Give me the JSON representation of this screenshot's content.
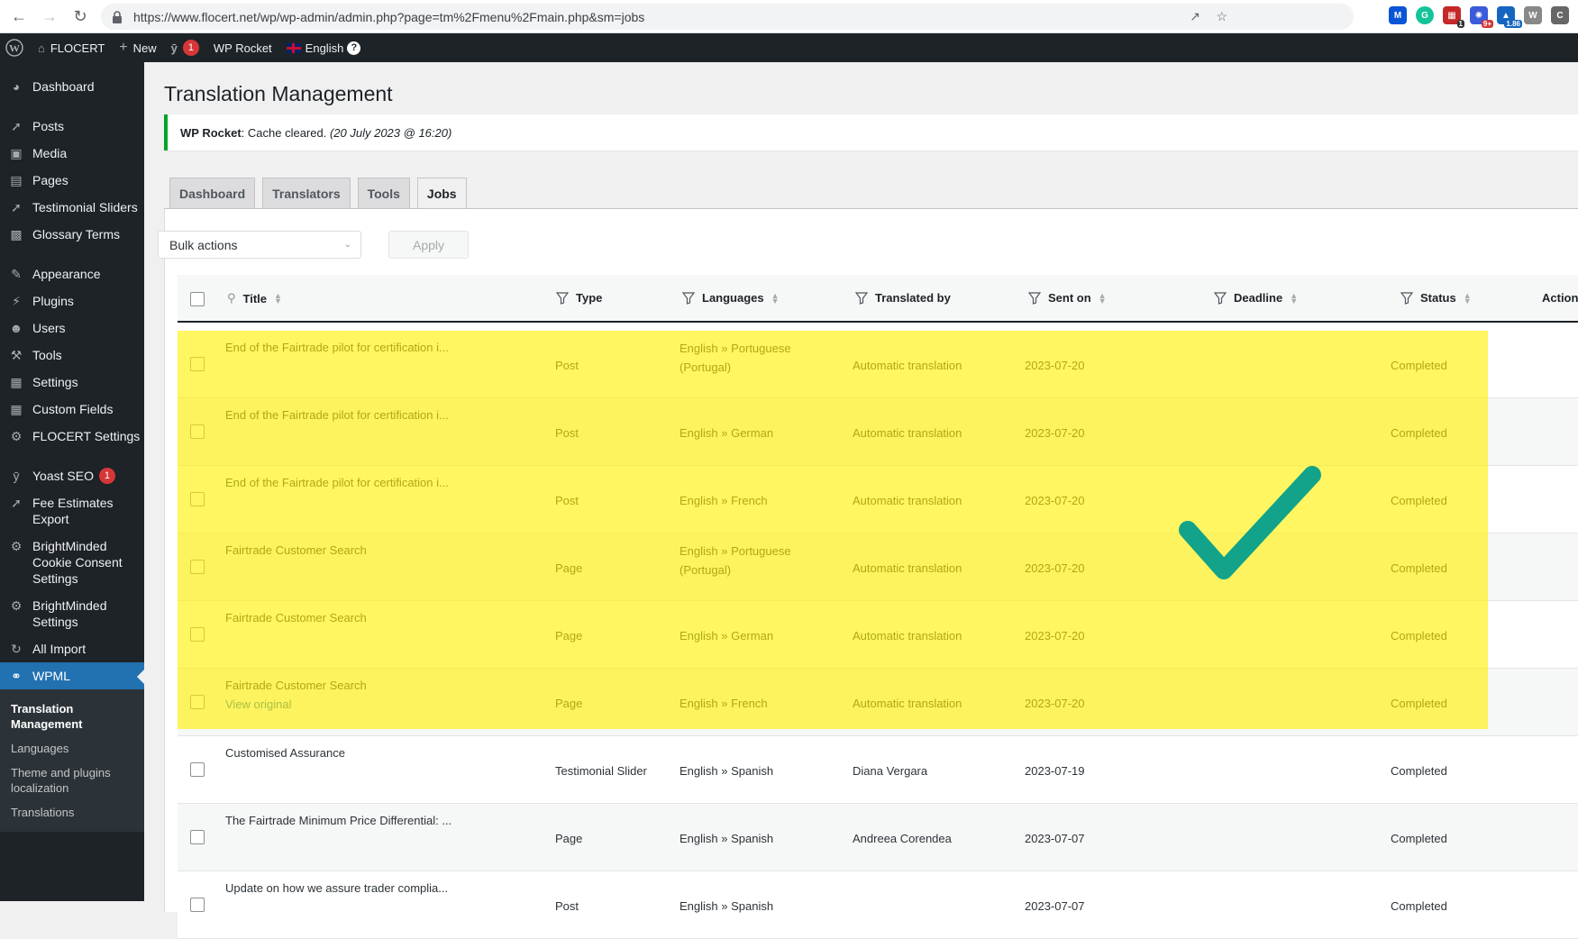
{
  "browser": {
    "url": "https://www.flocert.net/wp/wp-admin/admin.php?page=tm%2Fmenu%2Fmain.php&sm=jobs",
    "ext_badges": [
      "1",
      "9+",
      "1.86"
    ]
  },
  "adminbar": {
    "site_name": "FLOCERT",
    "new_label": "New",
    "yoast_count": "1",
    "wp_rocket": "WP Rocket",
    "language": "English"
  },
  "sidebar": {
    "items": [
      {
        "label": "Dashboard",
        "icon": "dashboard-icon"
      },
      {
        "label": "Posts",
        "icon": "pin-icon"
      },
      {
        "label": "Media",
        "icon": "media-icon"
      },
      {
        "label": "Pages",
        "icon": "pages-icon"
      },
      {
        "label": "Testimonial Sliders",
        "icon": "pin-icon"
      },
      {
        "label": "Glossary Terms",
        "icon": "book-icon"
      },
      {
        "label": "Appearance",
        "icon": "brush-icon"
      },
      {
        "label": "Plugins",
        "icon": "plug-icon"
      },
      {
        "label": "Users",
        "icon": "user-icon"
      },
      {
        "label": "Tools",
        "icon": "wrench-icon"
      },
      {
        "label": "Settings",
        "icon": "settings-icon"
      },
      {
        "label": "Custom Fields",
        "icon": "table-icon"
      },
      {
        "label": "FLOCERT Settings",
        "icon": "gear-icon"
      },
      {
        "label": "Yoast SEO",
        "icon": "yoast-icon",
        "badge": "1"
      },
      {
        "label": "Fee Estimates Export",
        "icon": "pin-icon"
      },
      {
        "label": "BrightMinded Cookie Consent Settings",
        "icon": "gear-icon"
      },
      {
        "label": "BrightMinded Settings",
        "icon": "gear-icon"
      },
      {
        "label": "All Import",
        "icon": "import-icon"
      },
      {
        "label": "WPML",
        "icon": "wpml-icon"
      }
    ],
    "submenu": [
      "Translation Management",
      "Languages",
      "Theme and plugins localization",
      "Translations"
    ]
  },
  "page": {
    "title": "Translation Management",
    "notice_strong": "WP Rocket",
    "notice_text": ": Cache cleared.",
    "notice_date": "(20 July 2023 @ 16:20)",
    "tabs": [
      "Dashboard",
      "Translators",
      "Tools",
      "Jobs"
    ],
    "bulk_actions": "Bulk actions",
    "apply": "Apply"
  },
  "table": {
    "columns": [
      "Title",
      "Type",
      "Languages",
      "Translated by",
      "Sent on",
      "Deadline",
      "Status",
      "Action"
    ],
    "rows": [
      {
        "title": "End of the Fairtrade pilot for certification i...",
        "type": "Post",
        "lang": "English » Portuguese",
        "lang2": "(Portugal)",
        "by": "Automatic translation",
        "sent": "2023-07-20",
        "status": "Completed"
      },
      {
        "title": "End of the Fairtrade pilot for certification i...",
        "type": "Post",
        "lang": "English » German",
        "lang2": "",
        "by": "Automatic translation",
        "sent": "2023-07-20",
        "status": "Completed"
      },
      {
        "title": "End of the Fairtrade pilot for certification i...",
        "type": "Post",
        "lang": "English » French",
        "lang2": "",
        "by": "Automatic translation",
        "sent": "2023-07-20",
        "status": "Completed"
      },
      {
        "title": "Fairtrade Customer Search",
        "type": "Page",
        "lang": "English » Portuguese",
        "lang2": "(Portugal)",
        "by": "Automatic translation",
        "sent": "2023-07-20",
        "status": "Completed"
      },
      {
        "title": "Fairtrade Customer Search",
        "type": "Page",
        "lang": "English » German",
        "lang2": "",
        "by": "Automatic translation",
        "sent": "2023-07-20",
        "status": "Completed"
      },
      {
        "title": "Fairtrade Customer Search",
        "sub": "View original",
        "type": "Page",
        "lang": "English » French",
        "lang2": "",
        "by": "Automatic translation",
        "sent": "2023-07-20",
        "status": "Completed"
      },
      {
        "title": "Customised Assurance",
        "type": "Testimonial Slider",
        "lang": "English » Spanish",
        "lang2": "",
        "by": "Diana Vergara",
        "sent": "2023-07-19",
        "status": "Completed"
      },
      {
        "title": "The Fairtrade Minimum Price Differential: ...",
        "type": "Page",
        "lang": "English » Spanish",
        "lang2": "",
        "by": "Andreea Corendea",
        "sent": "2023-07-07",
        "status": "Completed"
      },
      {
        "title": "Update on how we assure trader complia...",
        "type": "Post",
        "lang": "English » Spanish",
        "lang2": "",
        "by": "",
        "sent": "2023-07-07",
        "status": "Completed"
      }
    ]
  },
  "colors": {
    "highlight": "#fff100",
    "checkmark": "#12a38a",
    "wp_blue": "#2271b1"
  }
}
